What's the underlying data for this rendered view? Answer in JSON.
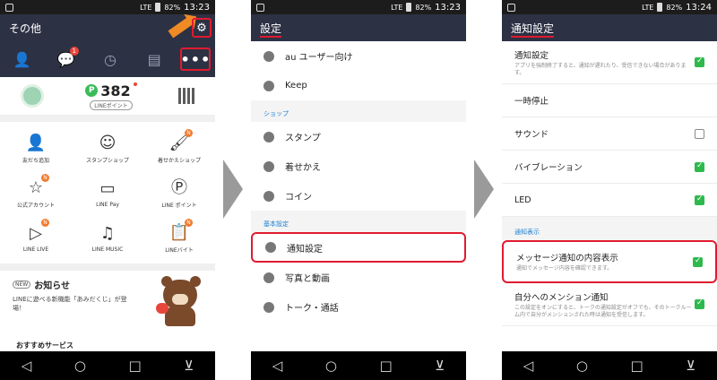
{
  "status": {
    "p1_time": "13:23",
    "p2_time": "13:23",
    "p3_time": "13:24",
    "battery": "82%",
    "network": "LTE"
  },
  "panel1": {
    "title": "その他",
    "tab_badge": "1",
    "points_value": "382",
    "points_badge": "P",
    "points_label": "LINEポイント",
    "grid": [
      {
        "label": "友だち追加",
        "icon": "person-add-icon",
        "glyph": "👤",
        "badge": ""
      },
      {
        "label": "スタンプショップ",
        "icon": "sticker-face-icon",
        "glyph": "☺",
        "badge": ""
      },
      {
        "label": "着せかえショップ",
        "icon": "brush-icon",
        "glyph": "🖌",
        "badge": "N"
      },
      {
        "label": "公式アカウント",
        "icon": "shield-star-icon",
        "glyph": "☆",
        "badge": "N"
      },
      {
        "label": "LINE Pay",
        "icon": "card-icon",
        "glyph": "▭",
        "badge": ""
      },
      {
        "label": "LINE ポイント",
        "icon": "p-circle-icon",
        "glyph": "Ⓟ",
        "badge": ""
      },
      {
        "label": "LINE LIVE",
        "icon": "play-icon",
        "glyph": "▷",
        "badge": "N"
      },
      {
        "label": "LINE MUSIC",
        "icon": "music-note-icon",
        "glyph": "♫",
        "badge": ""
      },
      {
        "label": "LINEバイト",
        "icon": "clipboard-icon",
        "glyph": "📋",
        "badge": "N"
      }
    ],
    "news_tag": "NEW",
    "news_title": "お知らせ",
    "news_body": "LINEに遊べる新機能「あみだくじ」が登場！",
    "reco": "おすすめサービス"
  },
  "panel2": {
    "title": "設定",
    "rows": [
      {
        "label": "au ユーザー向け",
        "icon": "au-icon"
      },
      {
        "label": "Keep",
        "icon": "keep-icon"
      }
    ],
    "shop_section": "ショップ",
    "shop_rows": [
      {
        "label": "スタンプ",
        "icon": "sticker-icon"
      },
      {
        "label": "着せかえ",
        "icon": "theme-brush-icon"
      },
      {
        "label": "コイン",
        "icon": "coin-icon"
      }
    ],
    "basic_section": "基本設定",
    "basic_rows": [
      {
        "label": "通知設定",
        "icon": "speaker-icon"
      },
      {
        "label": "写真と動画",
        "icon": "photo-video-icon"
      },
      {
        "label": "トーク・通話",
        "icon": "talk-icon"
      }
    ]
  },
  "panel3": {
    "title": "通知設定",
    "rows": [
      {
        "label": "通知設定",
        "sub": "アプリを強制終了すると、通知が遅れたり、受信できない場合があります。",
        "checked": true,
        "checkbox": true
      },
      {
        "label": "一時停止",
        "sub": "",
        "checked": false,
        "checkbox": false
      },
      {
        "label": "サウンド",
        "sub": "",
        "checked": false,
        "checkbox": true
      },
      {
        "label": "バイブレーション",
        "sub": "",
        "checked": true,
        "checkbox": true
      },
      {
        "label": "LED",
        "sub": "",
        "checked": true,
        "checkbox": true
      }
    ],
    "section": "通知表示",
    "rows2": [
      {
        "label": "メッセージ通知の内容表示",
        "sub": "通知でメッセージ内容を確認できます。",
        "checked": true
      },
      {
        "label": "自分へのメンション通知",
        "sub": "この設定をオンにすると、トークの通知設定がオフでも、そのトークルーム内で自分がメンションされた時は通知を受信します。",
        "checked": true
      }
    ]
  }
}
